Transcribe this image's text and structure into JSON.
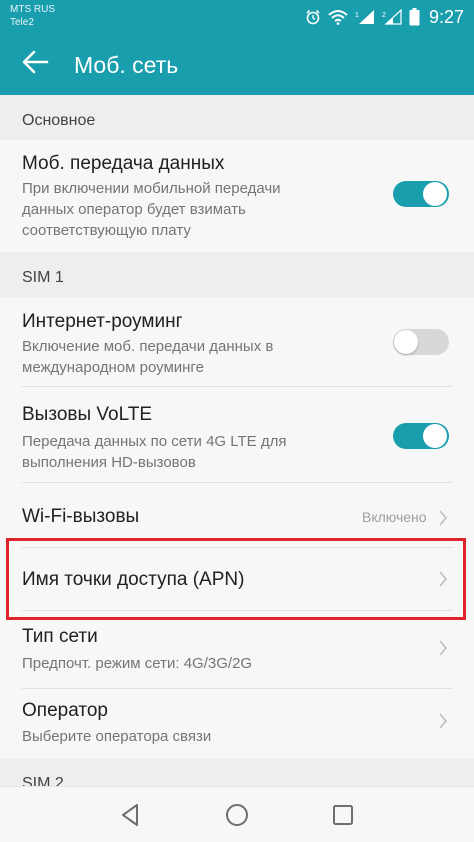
{
  "status_bar": {
    "carrier_1": "MTS RUS",
    "carrier_2": "Tele2",
    "time": "9:27",
    "icons": [
      "alarm-icon",
      "wifi-icon",
      "sim1-signal-icon",
      "sim2-signal-icon",
      "battery-icon"
    ]
  },
  "header": {
    "back_icon": "arrow-left-icon",
    "title": "Моб. сеть",
    "color": "#199ead"
  },
  "sections": {
    "basic": "Основное",
    "sim1": "SIM 1",
    "sim2": "SIM 2"
  },
  "rows": {
    "mobile_data": {
      "title": "Моб. передача данных",
      "sub": [
        "При включении мобильной передачи",
        "данных оператор будет взимать",
        "соответствующую плату"
      ],
      "toggle": "on"
    },
    "roaming": {
      "title": "Интернет-роуминг",
      "sub": [
        "Включение моб. передачи данных в",
        "международном роуминге"
      ],
      "toggle": "off"
    },
    "volte": {
      "title": "Вызовы VoLTE",
      "sub": [
        "Передача данных по сети 4G LTE для",
        "выполнения HD-вызовов"
      ],
      "toggle": "on"
    },
    "wifi_calls": {
      "title": "Wi-Fi-вызовы",
      "value": "Включено"
    },
    "apn": {
      "title": "Имя точки доступа (APN)"
    },
    "network_type": {
      "title": "Тип сети",
      "sub": "Предпочт. режим сети: 4G/3G/2G"
    },
    "operator": {
      "title": "Оператор",
      "sub": "Выберите оператора связи"
    }
  },
  "highlight_color": "#e0242b",
  "nav": {
    "icons": [
      "back-triangle-icon",
      "home-circle-icon",
      "recents-square-icon"
    ]
  }
}
